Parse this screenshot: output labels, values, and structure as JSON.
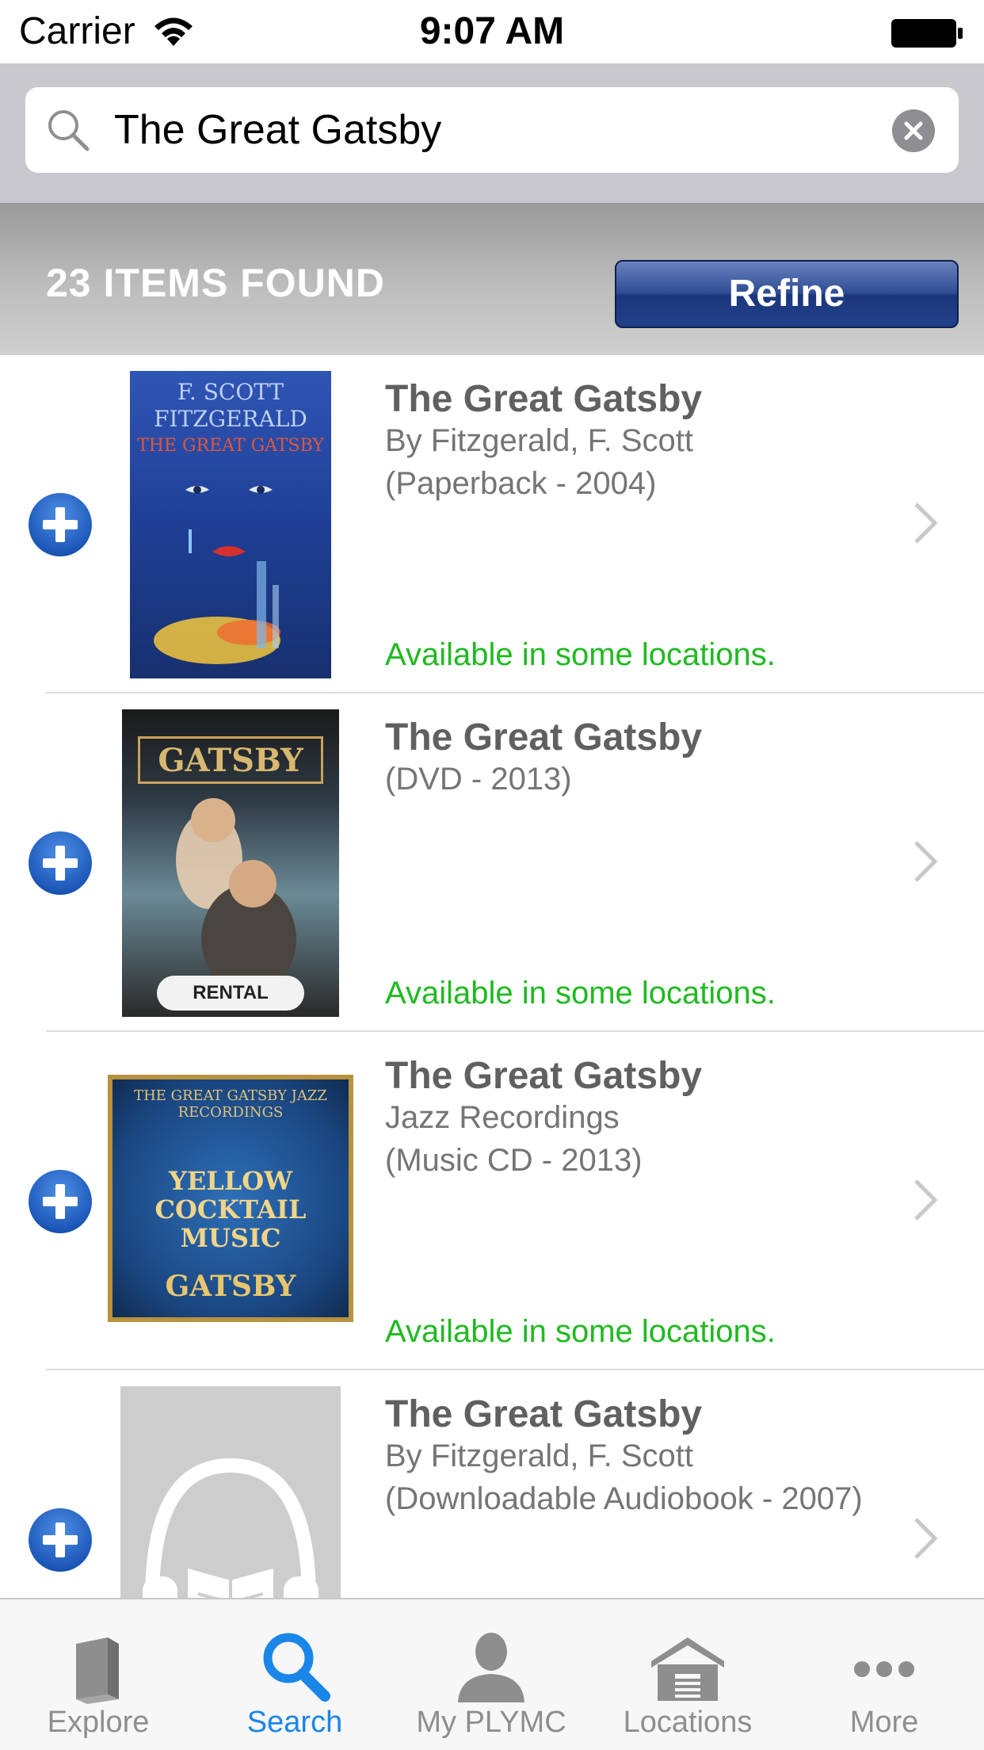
{
  "status_bar": {
    "carrier": "Carrier",
    "time": "9:07 AM"
  },
  "search": {
    "query": "The Great Gatsby",
    "placeholder": ""
  },
  "results": {
    "count_label": "23 ITEMS FOUND",
    "refine_label": "Refine"
  },
  "items": [
    {
      "title": "The Great Gatsby",
      "line1": "By Fitzgerald, F. Scott",
      "line2": "(Paperback - 2004)",
      "availability": "Available in some locations.",
      "cover": {
        "top": "F. SCOTT",
        "middle": "FITZGERALD",
        "bottom": "THE GREAT GATSBY"
      }
    },
    {
      "title": "The Great Gatsby",
      "line1": "(DVD - 2013)",
      "line2": "",
      "availability": "Available in some locations.",
      "cover": {
        "top": "GATSBY",
        "badge": "RENTAL"
      }
    },
    {
      "title": "The Great Gatsby",
      "line1": "Jazz Recordings",
      "line2": "(Music CD - 2013)",
      "availability": "Available in some locations.",
      "cover": {
        "top": "THE GREAT GATSBY JAZZ RECORDINGS",
        "line1": "YELLOW",
        "line2": "COCKTAIL",
        "line3": "MUSIC",
        "bottom": "GATSBY"
      }
    },
    {
      "title": "The Great Gatsby",
      "line1": "By Fitzgerald, F. Scott",
      "line2": "(Downloadable Audiobook - 2007)",
      "availability": "",
      "cover": {}
    }
  ],
  "tabs": [
    {
      "label": "Explore",
      "icon": "book-icon"
    },
    {
      "label": "Search",
      "icon": "search-icon",
      "active": true
    },
    {
      "label": "My PLYMC",
      "icon": "person-icon"
    },
    {
      "label": "Locations",
      "icon": "building-icon"
    },
    {
      "label": "More",
      "icon": "more-icon"
    }
  ],
  "colors": {
    "accent": "#1a86e8",
    "available": "#1fba1f",
    "refine": "#2c4a94"
  }
}
